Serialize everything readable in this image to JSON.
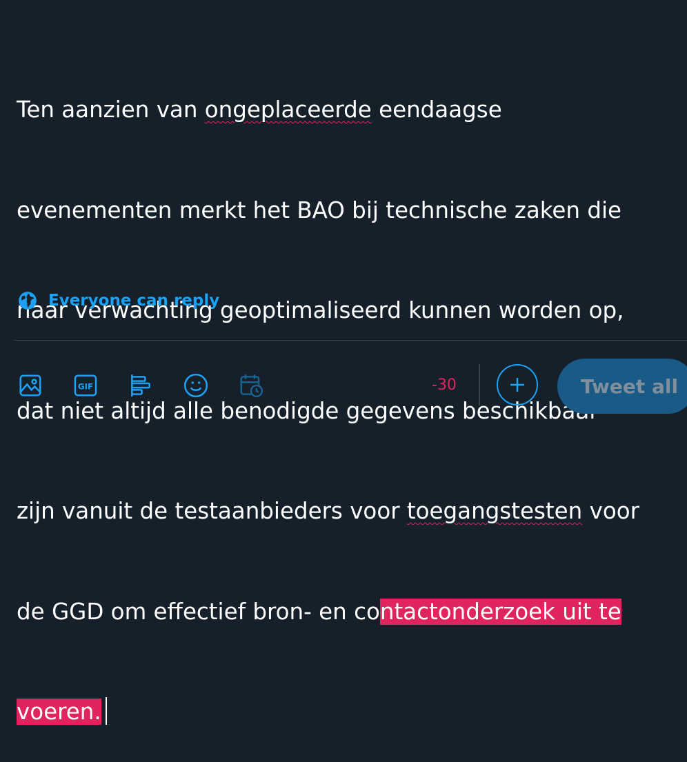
{
  "compose": {
    "l1_a": "Ten aanzien van ",
    "l1_misspelled": "ongeplaceerde",
    "l1_b": " eendaagse",
    "l2": "evenementen merkt het BAO bij technische zaken die",
    "l3": "naar verwachting geoptimaliseerd kunnen worden op,",
    "l4": "dat niet altijd alle benodigde gegevens beschikbaar",
    "l5_a": "zijn vanuit de testaanbieders voor ",
    "l5_misspelled": "toegangstesten",
    "l5_b": " voor",
    "l6_a": "de GGD om effectief bron- en co",
    "l6_over": "ntactonderzoek uit te",
    "l7_over": "voeren."
  },
  "reply": {
    "label": "Everyone can reply",
    "icon": "globe-icon"
  },
  "toolbar": {
    "icons": [
      "image-icon",
      "gif-icon",
      "poll-icon",
      "emoji-icon",
      "schedule-icon"
    ]
  },
  "counter": {
    "value": "-30"
  },
  "actions": {
    "tweet_all": "Tweet all"
  },
  "colors": {
    "background": "#15202b",
    "accent": "#1da1f2",
    "overflow": "#e0245e",
    "divider": "#38444d"
  }
}
